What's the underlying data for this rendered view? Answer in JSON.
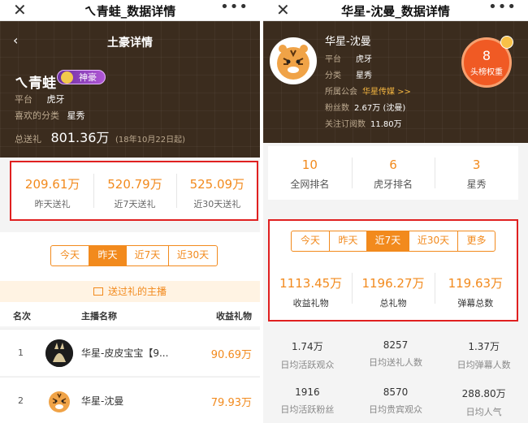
{
  "left": {
    "title": "ㄟ青蛙_数据详情",
    "more": "•••",
    "close": "✕",
    "header": "土豪详情",
    "back": "‹",
    "user_name": "ㄟ青蛙",
    "badge": "神豪",
    "platform_label": "平台",
    "platform": "虎牙",
    "fav_label": "喜欢的分类",
    "fav": "星秀",
    "total_label": "总送礼",
    "total_value": "801.36万",
    "total_note": "(18年10月22日起)",
    "stats": [
      {
        "value": "209.61万",
        "label": "昨天送礼"
      },
      {
        "value": "520.79万",
        "label": "近7天送礼"
      },
      {
        "value": "525.09万",
        "label": "近30天送礼"
      }
    ],
    "tabs": [
      "今天",
      "昨天",
      "近7天",
      "近30天"
    ],
    "active_tab": "昨天",
    "gift_header": "送过礼的主播",
    "columns": [
      "名次",
      "主播名称",
      "收益礼物"
    ],
    "rows": [
      {
        "rank": "1",
        "name": "华星-皮皮宝宝【9...",
        "value": "90.69万"
      },
      {
        "rank": "2",
        "name": "华星-沈曼",
        "value": "79.93万"
      }
    ]
  },
  "right": {
    "title": "华星-沈曼_数据详情",
    "more": "•••",
    "close": "✕",
    "streamer_name": "华星-沈曼",
    "platform_label": "平台",
    "platform": "虎牙",
    "category_label": "分类",
    "category": "星秀",
    "guild_label": "所属公会",
    "guild": "华星传媒 >>",
    "fans_label": "粉丝数",
    "fans": "2.67万 (沈曼)",
    "subs_label": "关注订阅数",
    "subs": "11.80万",
    "weight_value": "8",
    "weight_label": "头榜权重",
    "ranks": [
      {
        "value": "10",
        "label": "全网排名"
      },
      {
        "value": "6",
        "label": "虎牙排名"
      },
      {
        "value": "3",
        "label": "星秀"
      }
    ],
    "tabs": [
      "今天",
      "昨天",
      "近7天",
      "近30天",
      "更多"
    ],
    "active_tab": "近7天",
    "stats": [
      {
        "value": "1113.45万",
        "label": "收益礼物"
      },
      {
        "value": "1196.27万",
        "label": "总礼物"
      },
      {
        "value": "119.63万",
        "label": "弹幕总数"
      }
    ],
    "metrics": [
      {
        "value": "1.74万",
        "label": "日均活跃观众"
      },
      {
        "value": "8257",
        "label": "日均送礼人数"
      },
      {
        "value": "1.37万",
        "label": "日均弹幕人数"
      },
      {
        "value": "1916",
        "label": "日均活跃粉丝"
      },
      {
        "value": "8570",
        "label": "日均贵宾观众"
      },
      {
        "value": "288.80万",
        "label": "日均人气"
      }
    ]
  }
}
